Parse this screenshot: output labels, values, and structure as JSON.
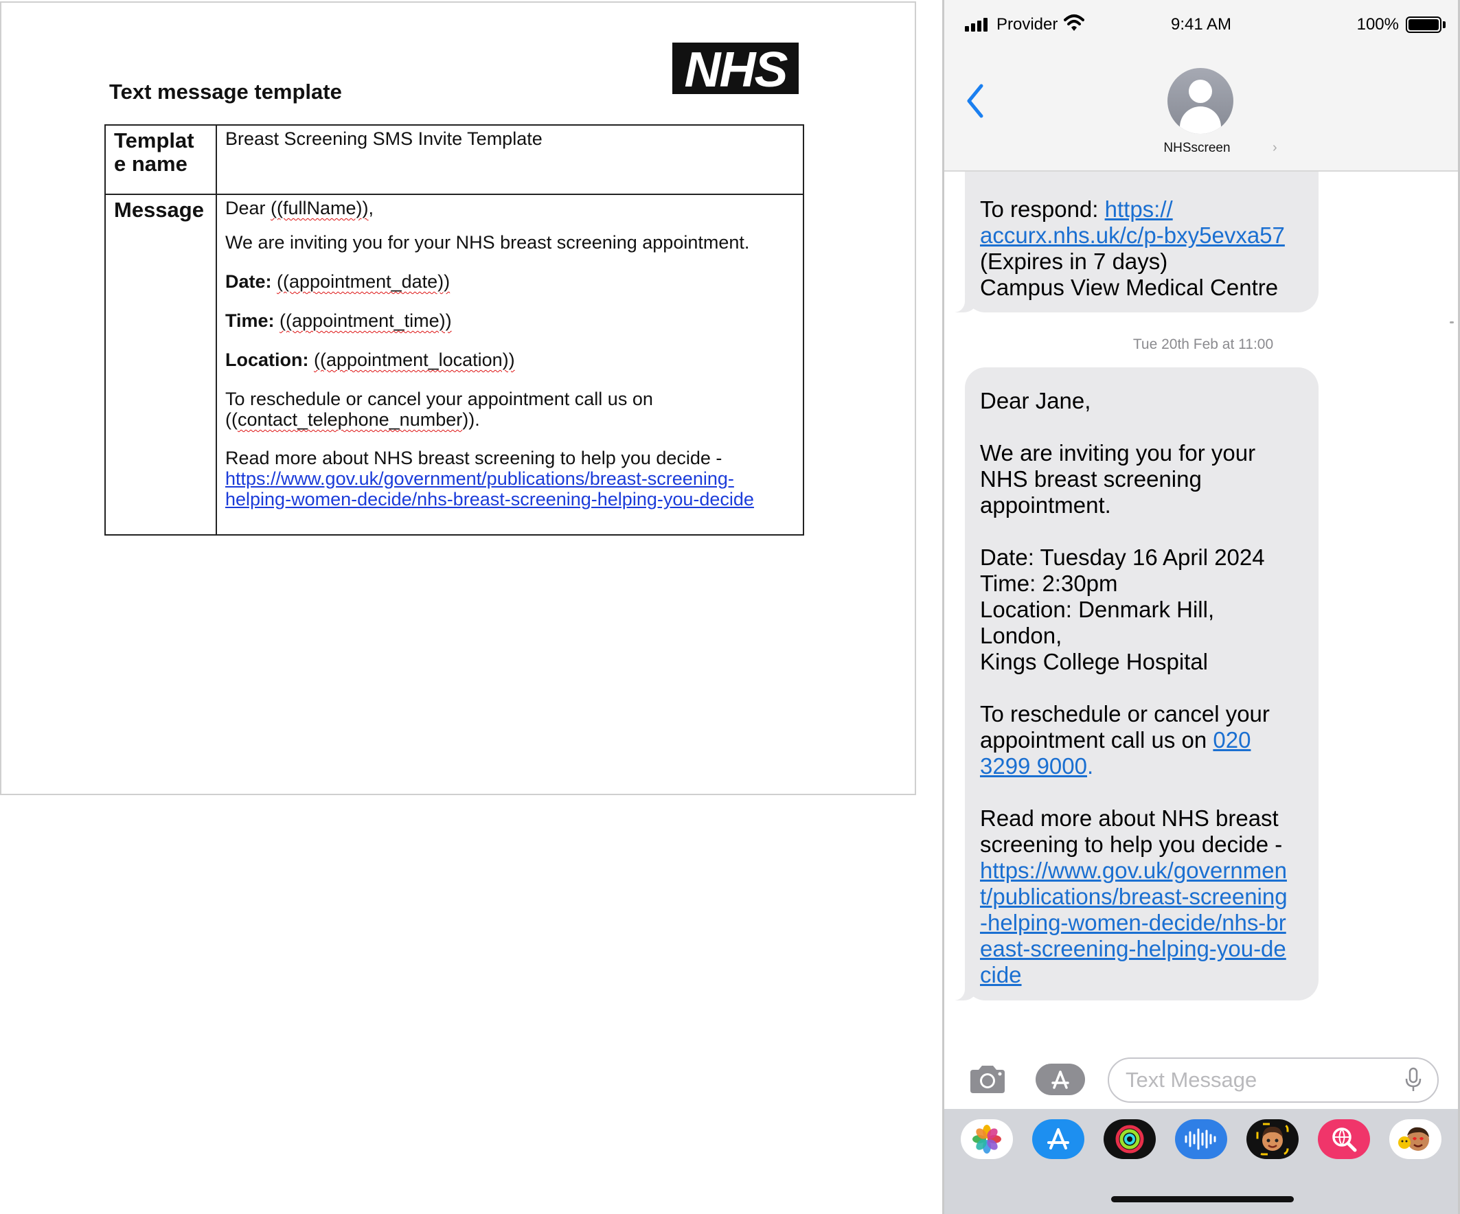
{
  "document": {
    "title": "Text message template",
    "logo_text": "NHS",
    "template_name_label": "Template name",
    "template_name_value": "Breast Screening SMS Invite Template",
    "message_label": "Message",
    "message": {
      "greeting_prefix": "Dear ",
      "greeting_var": "((fullName))",
      "greeting_suffix": ",",
      "intro": "We are inviting you for your NHS breast screening appointment.",
      "date_label": "Date:",
      "date_var": "((appointment_date))",
      "time_label": "Time:",
      "time_var": "((appointment_time))",
      "location_label": "Location:",
      "location_var": "((appointment_location))",
      "reschedule_text": "To reschedule or cancel your appointment call us on",
      "phone_var_open": "((",
      "phone_var": "contact_telephone_number",
      "phone_var_close": ")).",
      "read_more": "Read more about NHS breast screening to help you decide -",
      "link_line1": "https://www.gov.uk/government/publications/breast-screening-",
      "link_line2": "helping-women-decide/nhs-breast-screening-helping-you-decide"
    }
  },
  "phone": {
    "status": {
      "provider": "Provider",
      "time": "9:41 AM",
      "battery": "100%"
    },
    "contact_name": "NHSscreen",
    "previous_message": {
      "respond_prefix": "To respond: ",
      "respond_link_1": "https://",
      "respond_link_2": "accurx.nhs.uk/c/p-bxy5evxa57",
      "expires": "(Expires in 7 days)",
      "sender": "Campus View Medical Centre"
    },
    "timestamp": "Tue 20th Feb at 11:00",
    "message": {
      "greeting": "Dear Jane,",
      "intro_1": "We are inviting you for your",
      "intro_2": "NHS breast screening",
      "intro_3": "appointment.",
      "date": "Date: Tuesday 16 April 2024",
      "time": "Time: 2:30pm",
      "location_1": "Location: Denmark Hill,",
      "location_2": "London,",
      "location_3": "Kings College Hospital",
      "reschedule_1": "To reschedule or cancel your",
      "reschedule_2": "appointment call us on ",
      "phone_1": "020",
      "phone_2": "3299 9000",
      "phone_suffix": ".",
      "read_more_1": "Read more about NHS breast",
      "read_more_2": "screening to help you decide -",
      "link_1": "https://www.gov.uk/governmen",
      "link_2": "t/publications/breast-screening",
      "link_3": "-helping-women-decide/nhs-br",
      "link_4": "east-screening-helping-you-de",
      "link_5": "cide"
    },
    "compose_placeholder": "Text Message",
    "apps": [
      "photos-icon",
      "app-store-icon",
      "fitness-icon",
      "audio-icon",
      "memoji-icon",
      "search-globe-icon",
      "animoji-icon"
    ],
    "colors": {
      "bubble": "#e9e9eb",
      "link": "#1a6fd1",
      "accent": "#1a7ff0",
      "drawer": "#d3d5da"
    }
  }
}
